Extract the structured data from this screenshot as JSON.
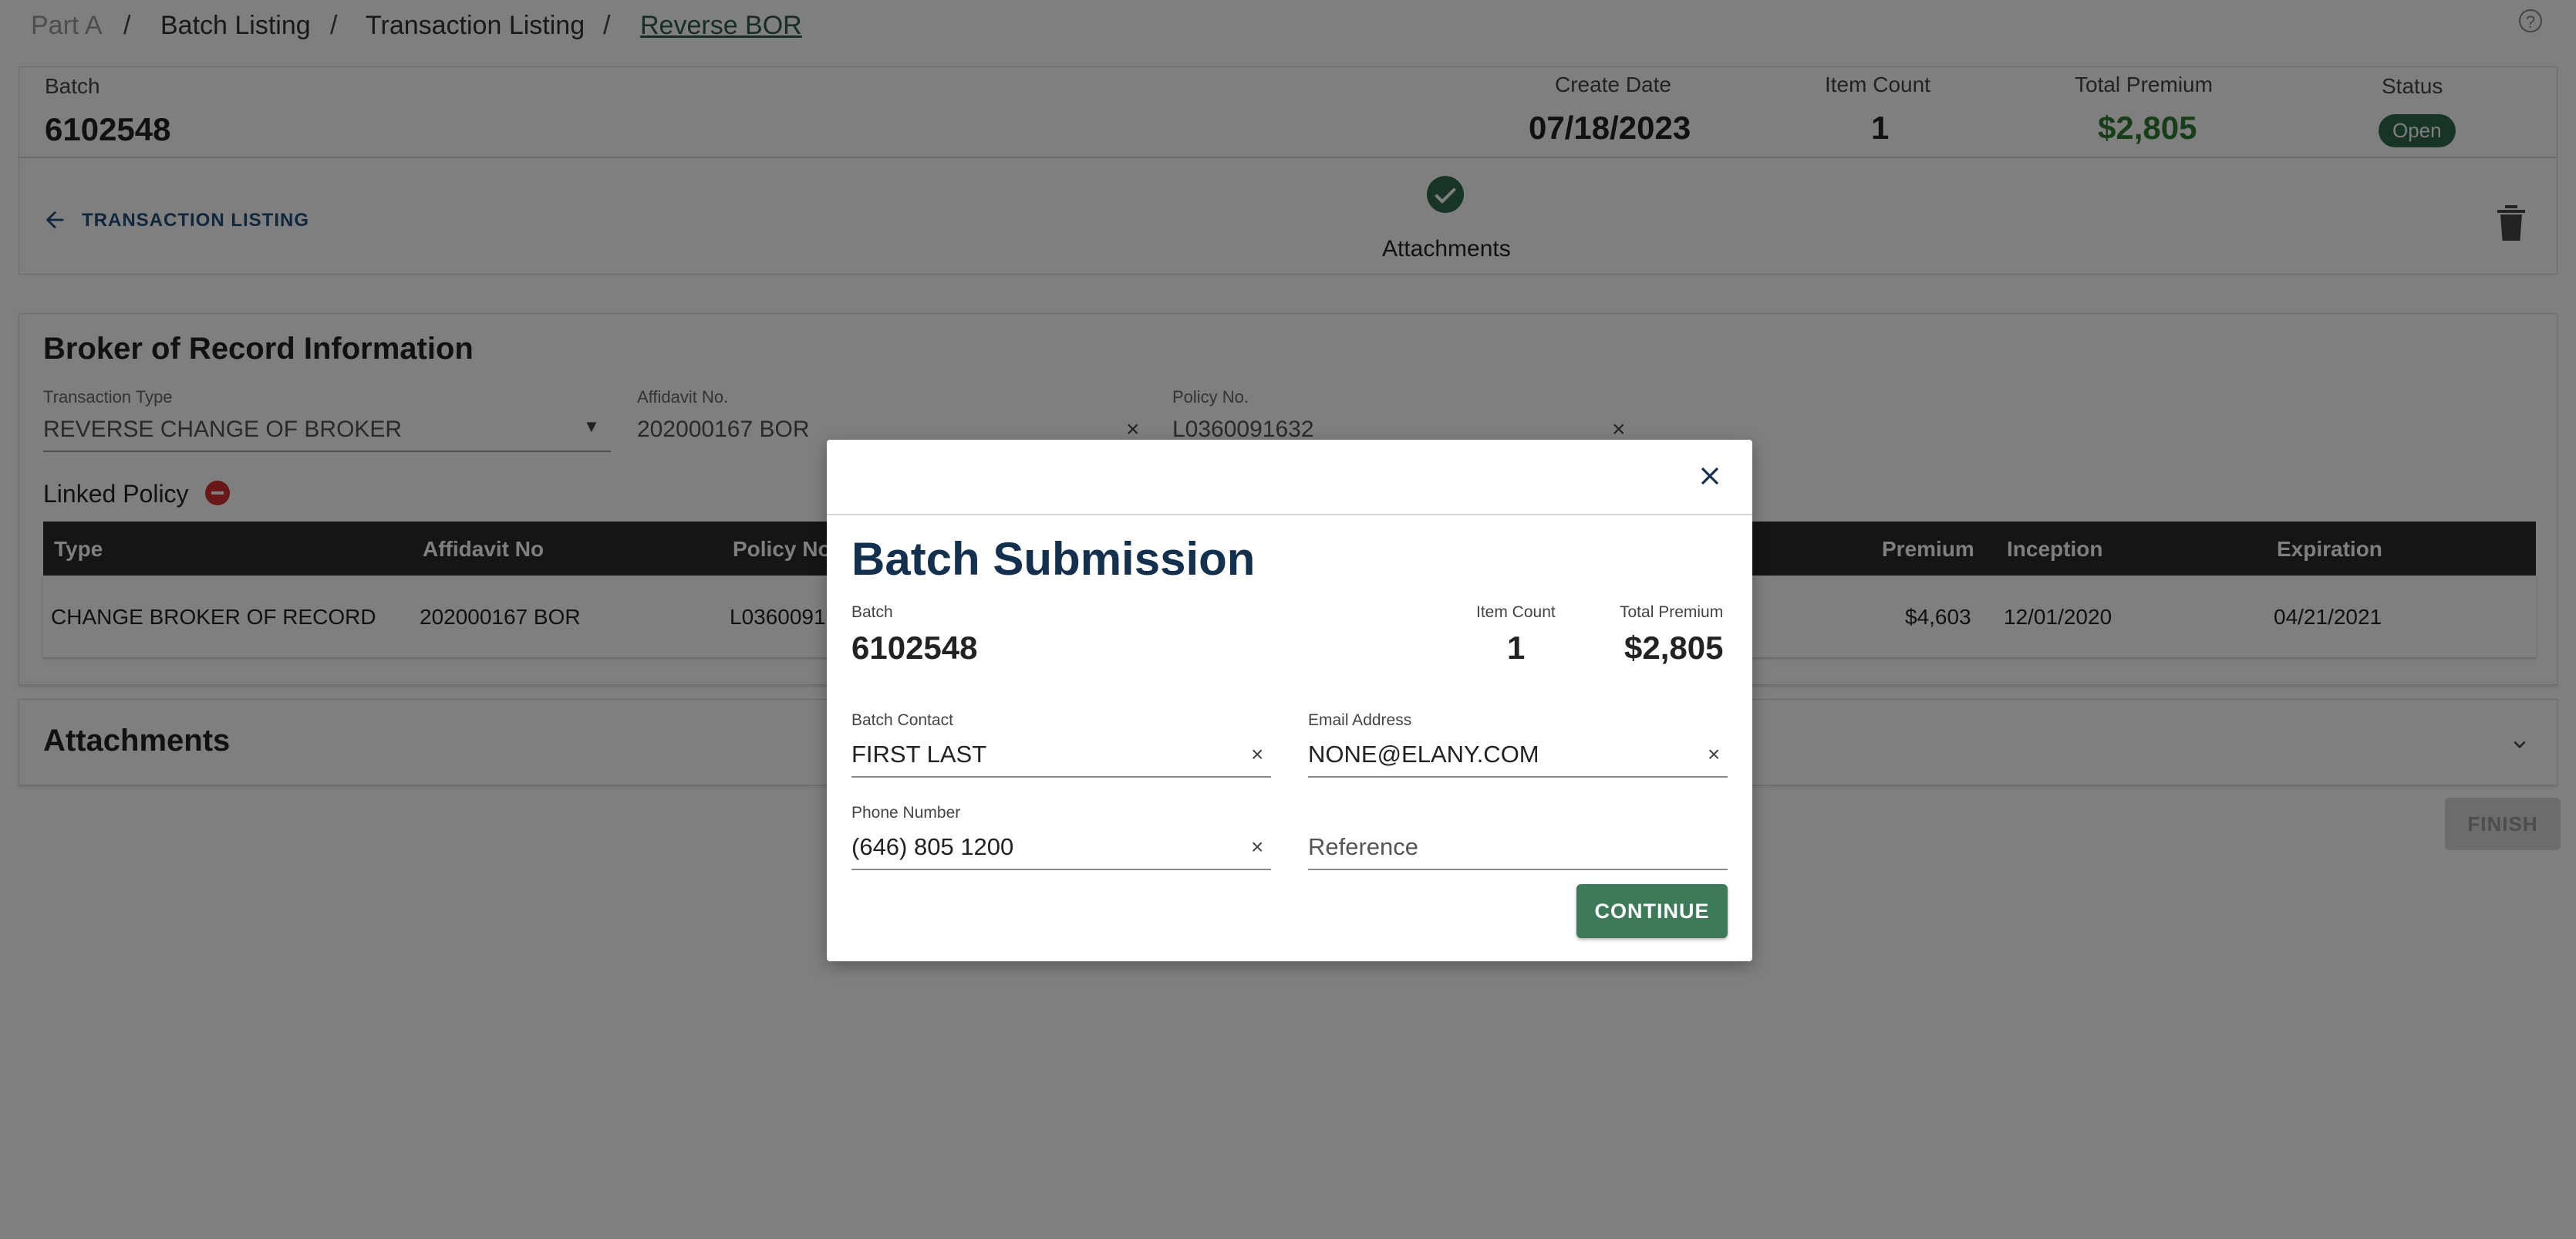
{
  "breadcrumb": {
    "part": "Part A",
    "batch_listing": "Batch Listing",
    "transaction_listing": "Transaction Listing",
    "current": "Reverse BOR",
    "separator": "/"
  },
  "help_icon": "question-circle-icon",
  "batch_header": {
    "batch_label": "Batch",
    "batch_value": "6102548",
    "create_date_label": "Create Date",
    "create_date_value": "07/18/2023",
    "item_count_label": "Item Count",
    "item_count_value": "1",
    "total_premium_label": "Total Premium",
    "total_premium_value": "$2,805",
    "status_label": "Status",
    "status_value": "Open",
    "status_color": "#2e6b4e",
    "premium_color": "#2e7d32"
  },
  "toolbar": {
    "back_label": "TRANSACTION LISTING",
    "attachments_label": "Attachments",
    "attachments_icon": "check-circle-icon",
    "delete_icon": "trash-icon"
  },
  "bor_section": {
    "title": "Broker of Record Information",
    "transaction_type_label": "Transaction Type",
    "transaction_type_value": "REVERSE CHANGE OF BROKER",
    "affidavit_label": "Affidavit No.",
    "affidavit_value": "202000167  BOR",
    "policy_label": "Policy No.",
    "policy_value": "L0360091632",
    "linked_policy_label": "Linked Policy"
  },
  "linked_table": {
    "headers": {
      "type": "Type",
      "affidavit": "Affidavit No",
      "policy": "Policy No",
      "premium": "Premium",
      "inception": "Inception",
      "expiration": "Expiration"
    },
    "row": {
      "type": "CHANGE BROKER OF RECORD",
      "affidavit": "202000167 BOR",
      "policy": "L0360091",
      "premium": "$4,603",
      "inception": "12/01/2020",
      "expiration": "04/21/2021"
    }
  },
  "attachments_section": {
    "title": "Attachments"
  },
  "finish_label": "FINISH",
  "modal": {
    "title": "Batch Submission",
    "batch_label": "Batch",
    "batch_value": "6102548",
    "item_count_label": "Item Count",
    "item_count_value": "1",
    "total_premium_label": "Total Premium",
    "total_premium_value": "$2,805",
    "batch_contact_label": "Batch Contact",
    "batch_contact_value": "FIRST LAST",
    "email_label": "Email Address",
    "email_value": "NONE@ELANY.COM",
    "phone_label": "Phone Number",
    "phone_value": "(646) 805 1200",
    "reference_placeholder": "Reference",
    "continue_label": "CONTINUE",
    "title_color": "#14304f",
    "button_color": "#3d7a5a"
  }
}
